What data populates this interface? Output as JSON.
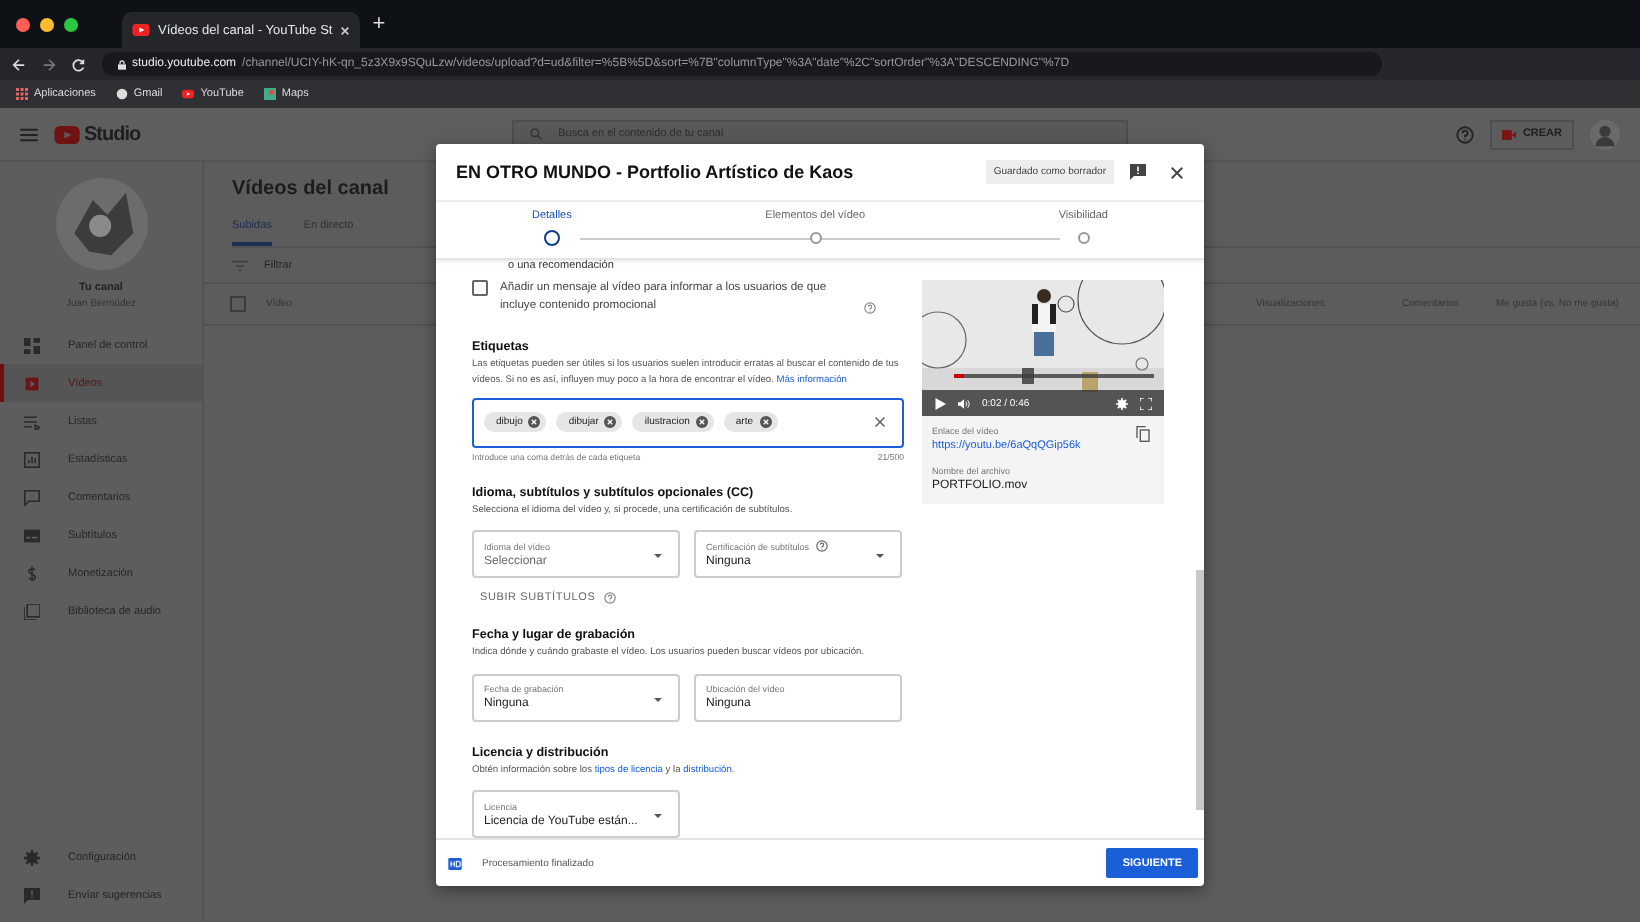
{
  "browser": {
    "tabs": [
      {
        "title": "Vídeos del canal - YouTube St",
        "selected": true
      }
    ],
    "new_tab": "+",
    "url_host": "studio.youtube.com",
    "url_path": "/channel/UCIY-hK-qn_5z3X9x9SQuLzw/videos/upload?d=ud&filter=%5B%5D&sort=%7B\"columnType\"%3A\"date\"%2C\"sortOrder\"%3A\"DESCENDING\"%7D",
    "bookmarks": [
      "Aplicaciones",
      "Gmail",
      "YouTube",
      "Maps"
    ]
  },
  "studio_header": {
    "logo": "Studio",
    "search_placeholder": "Busca en el contenido de tu canal",
    "create_button": "CREAR"
  },
  "sidebar": {
    "channel_title": "Tu canal",
    "channel_name": "Juan Bermúdez",
    "items": [
      {
        "label": "Panel de control",
        "selected": false
      },
      {
        "label": "Vídeos",
        "selected": true
      },
      {
        "label": "Listas",
        "selected": false
      },
      {
        "label": "Estadísticas",
        "selected": false
      },
      {
        "label": "Comentarios",
        "selected": false
      },
      {
        "label": "Subtítulos",
        "selected": false
      },
      {
        "label": "Monetización",
        "selected": false
      },
      {
        "label": "Biblioteca de audio",
        "selected": false
      }
    ],
    "bottom_items": [
      "Configuración",
      "Enviar sugerencias"
    ]
  },
  "main": {
    "title": "Vídeos del canal",
    "tabs": [
      {
        "label": "Subidas",
        "selected": true
      },
      {
        "label": "En directo",
        "selected": false
      }
    ],
    "filter_placeholder": "Filtrar",
    "select_all_checked": false,
    "columns": [
      "Vídeo",
      "Visualizaciones",
      "Comentarios",
      "Me gusta (vs. No me gusta)"
    ]
  },
  "dialog": {
    "title": "EN OTRO MUNDO - Portfolio Artístico de Kaos",
    "draft_status": "Guardado como borrador",
    "steps": [
      {
        "label": "Detalles",
        "selected": true
      },
      {
        "label": "Elementos del vídeo",
        "selected": false
      },
      {
        "label": "Visibilidad",
        "selected": false
      }
    ],
    "cut_line": "o una recomendación",
    "promo_checkbox": {
      "label": "Añadir un mensaje al vídeo para informar a los usuarios de que incluye contenido promocional",
      "checked": false
    },
    "tags": {
      "heading": "Etiquetas",
      "description": "Las etiquetas pueden ser útiles si los usuarios suelen introducir erratas al buscar el contenido de tus vídeos. Si no es así, influyen muy poco a la hora de encontrar el vídeo.",
      "link": "Más información",
      "chips": [
        "dibujo",
        "dibujar",
        "ilustracion",
        "arte"
      ],
      "hint": "Introduce una coma detrás de cada etiqueta",
      "counter": "21/500"
    },
    "language": {
      "heading": "Idioma, subtítulos y subtítulos opcionales (CC)",
      "description": "Selecciona el idioma del vídeo y, si procede, una certificación de subtítulos.",
      "video_language": {
        "label": "Idioma del vídeo",
        "placeholder": "Seleccionar"
      },
      "caption_cert": {
        "label": "Certificación de subtítulos",
        "value": "Ninguna"
      },
      "upload_button": "SUBIR SUBTÍTULOS"
    },
    "recording": {
      "heading": "Fecha y lugar de grabación",
      "description": "Indica dónde y cuándo grabaste el vídeo. Los usuarios pueden buscar vídeos por ubicación.",
      "date": {
        "label": "Fecha de grabación",
        "value": "Ninguna"
      },
      "location": {
        "label": "Ubicación del vídeo",
        "placeholder": "Ninguna"
      }
    },
    "license": {
      "heading": "Licencia y distribución",
      "text_before": "Obtén información sobre los",
      "link_1": "tipos de licencia",
      "text_middle": "y la",
      "link_2": "distribución",
      "text_after": ".",
      "select": {
        "label": "Licencia",
        "value": "Licencia de YouTube están..."
      }
    },
    "preview": {
      "time": "0:02 / 0:46",
      "level": 0.05,
      "link_label": "Enlace del vídeo",
      "link": "https://youtu.be/6aQqQGip56k",
      "filename_label": "Nombre del archivo",
      "filename": "PORTFOLIO.mov"
    },
    "footer": {
      "status": "Procesamiento finalizado",
      "next_button": "SIGUIENTE"
    }
  }
}
